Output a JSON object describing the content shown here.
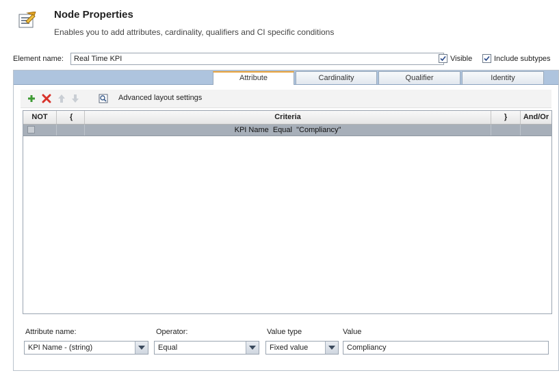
{
  "header": {
    "title": "Node Properties",
    "subtitle": "Enables you to add attributes, cardinality, qualifiers and CI specific conditions",
    "icon": "properties-document-icon"
  },
  "element": {
    "name_label": "Element name:",
    "name_value": "Real Time KPI",
    "visible_label": "Visible",
    "visible_checked": true,
    "include_subtypes_label": "Include subtypes",
    "include_subtypes_checked": true
  },
  "tabs": [
    {
      "label": "Attribute",
      "active": true
    },
    {
      "label": "Cardinality",
      "active": false
    },
    {
      "label": "Qualifier",
      "active": false
    },
    {
      "label": "Identity",
      "active": false
    }
  ],
  "toolbar": {
    "add_icon": "plus-icon",
    "delete_icon": "delete-x-icon",
    "move_up_icon": "arrow-up-icon",
    "move_down_icon": "arrow-down-icon",
    "layout_icon": "magnifier-icon",
    "advanced_label": "Advanced layout settings"
  },
  "grid": {
    "columns": [
      "NOT",
      "{",
      "Criteria",
      "}",
      "And/Or"
    ],
    "rows": [
      {
        "not": "",
        "open": "",
        "criteria": "KPI Name  Equal  \"Compliancy\"",
        "close": "",
        "andor": ""
      }
    ]
  },
  "form": {
    "attribute_name_label": "Attribute name:",
    "attribute_name_value": "KPI Name - (string)",
    "operator_label": "Operator:",
    "operator_value": "Equal",
    "value_type_label": "Value type",
    "value_type_value": "Fixed value",
    "value_label": "Value",
    "value_value": "Compliancy"
  },
  "colors": {
    "tab_bar": "#aec4de",
    "selected_row": "#a7afb9",
    "active_tab_accent": "#e8a13a",
    "delete_red": "#d8322a",
    "add_green": "#3d9a33"
  }
}
